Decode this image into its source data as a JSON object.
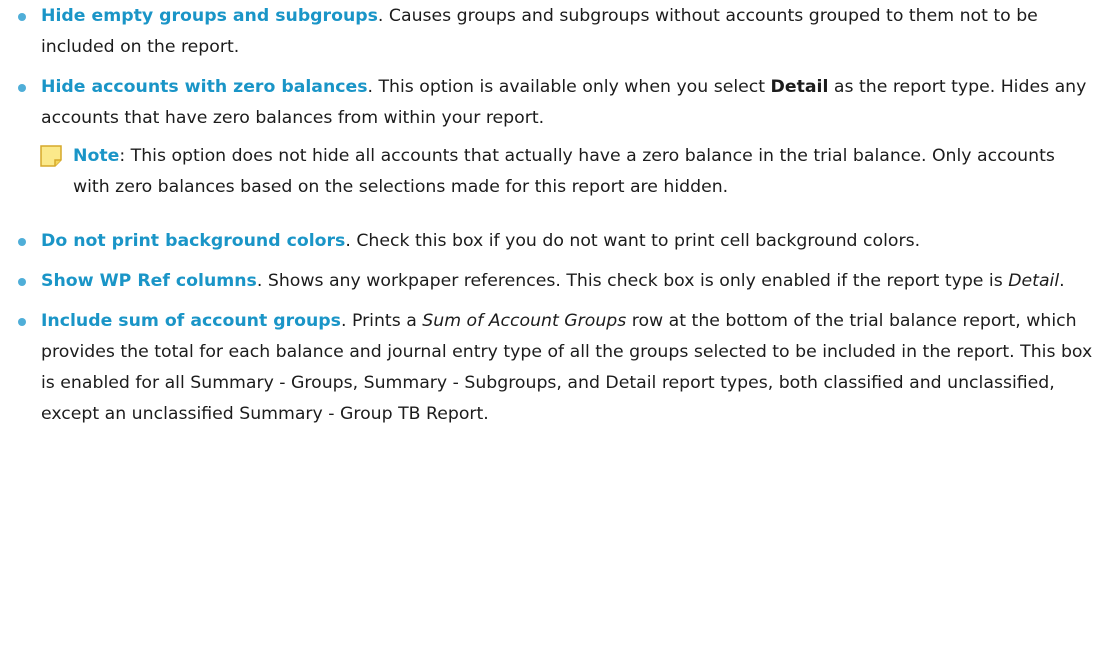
{
  "items": [
    {
      "term": "Hide empty groups and subgroups",
      "desc": ". Causes groups and subgroups without accounts grouped to them not to be included on the report."
    },
    {
      "term": "Hide accounts with zero balances",
      "desc_a": ". This option is available only when you select ",
      "desc_bold": "Detail",
      "desc_b": " as the report type. Hides any accounts that have zero balances from within your report.",
      "note": {
        "label": "Note",
        "text": ": This option does not hide all accounts that actually have a zero balance in the trial balance. Only accounts with zero balances based on the selections made for this report are hidden."
      }
    },
    {
      "term": "Do not print background colors",
      "desc": ". Check this box if you do not want to print cell background colors."
    },
    {
      "term": "Show WP Ref columns",
      "desc_a": ". Shows any workpaper references. This check box is only enabled if the report type is ",
      "desc_italic": "Detail",
      "desc_b": "."
    },
    {
      "term": "Include sum of account groups",
      "desc_a": ". Prints a ",
      "desc_italic": "Sum of Account Groups",
      "desc_b": " row at the bottom of the trial balance report, which provides the total for each balance and journal entry type of all the groups selected to be included in the report. This box is enabled for all Summary - Groups, Summary - Subgroups, and Detail report types, both classified and unclassified, except an unclassified Summary - Group TB Report."
    }
  ],
  "colors": {
    "term": "#1a95c7",
    "bullet": "#4faed8",
    "text": "#1c1c1c",
    "note_icon_fill": "#fbe98a",
    "note_icon_border": "#d6a92a"
  },
  "icons": {
    "note": "sticky-note-icon"
  }
}
